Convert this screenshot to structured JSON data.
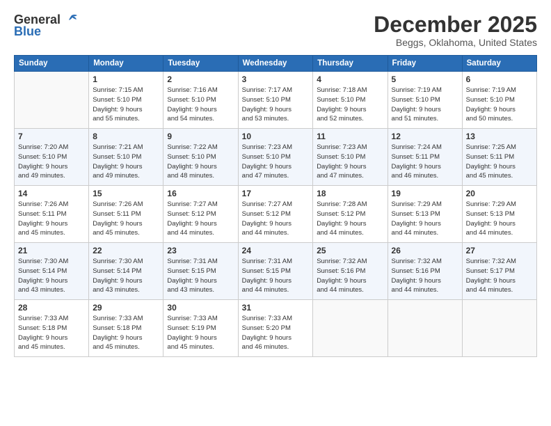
{
  "logo": {
    "line1": "General",
    "line2": "Blue"
  },
  "header": {
    "month": "December 2025",
    "location": "Beggs, Oklahoma, United States"
  },
  "weekdays": [
    "Sunday",
    "Monday",
    "Tuesday",
    "Wednesday",
    "Thursday",
    "Friday",
    "Saturday"
  ],
  "weeks": [
    [
      {
        "day": "",
        "info": ""
      },
      {
        "day": "1",
        "info": "Sunrise: 7:15 AM\nSunset: 5:10 PM\nDaylight: 9 hours\nand 55 minutes."
      },
      {
        "day": "2",
        "info": "Sunrise: 7:16 AM\nSunset: 5:10 PM\nDaylight: 9 hours\nand 54 minutes."
      },
      {
        "day": "3",
        "info": "Sunrise: 7:17 AM\nSunset: 5:10 PM\nDaylight: 9 hours\nand 53 minutes."
      },
      {
        "day": "4",
        "info": "Sunrise: 7:18 AM\nSunset: 5:10 PM\nDaylight: 9 hours\nand 52 minutes."
      },
      {
        "day": "5",
        "info": "Sunrise: 7:19 AM\nSunset: 5:10 PM\nDaylight: 9 hours\nand 51 minutes."
      },
      {
        "day": "6",
        "info": "Sunrise: 7:19 AM\nSunset: 5:10 PM\nDaylight: 9 hours\nand 50 minutes."
      }
    ],
    [
      {
        "day": "7",
        "info": "Sunrise: 7:20 AM\nSunset: 5:10 PM\nDaylight: 9 hours\nand 49 minutes."
      },
      {
        "day": "8",
        "info": "Sunrise: 7:21 AM\nSunset: 5:10 PM\nDaylight: 9 hours\nand 49 minutes."
      },
      {
        "day": "9",
        "info": "Sunrise: 7:22 AM\nSunset: 5:10 PM\nDaylight: 9 hours\nand 48 minutes."
      },
      {
        "day": "10",
        "info": "Sunrise: 7:23 AM\nSunset: 5:10 PM\nDaylight: 9 hours\nand 47 minutes."
      },
      {
        "day": "11",
        "info": "Sunrise: 7:23 AM\nSunset: 5:10 PM\nDaylight: 9 hours\nand 47 minutes."
      },
      {
        "day": "12",
        "info": "Sunrise: 7:24 AM\nSunset: 5:11 PM\nDaylight: 9 hours\nand 46 minutes."
      },
      {
        "day": "13",
        "info": "Sunrise: 7:25 AM\nSunset: 5:11 PM\nDaylight: 9 hours\nand 45 minutes."
      }
    ],
    [
      {
        "day": "14",
        "info": "Sunrise: 7:26 AM\nSunset: 5:11 PM\nDaylight: 9 hours\nand 45 minutes."
      },
      {
        "day": "15",
        "info": "Sunrise: 7:26 AM\nSunset: 5:11 PM\nDaylight: 9 hours\nand 45 minutes."
      },
      {
        "day": "16",
        "info": "Sunrise: 7:27 AM\nSunset: 5:12 PM\nDaylight: 9 hours\nand 44 minutes."
      },
      {
        "day": "17",
        "info": "Sunrise: 7:27 AM\nSunset: 5:12 PM\nDaylight: 9 hours\nand 44 minutes."
      },
      {
        "day": "18",
        "info": "Sunrise: 7:28 AM\nSunset: 5:12 PM\nDaylight: 9 hours\nand 44 minutes."
      },
      {
        "day": "19",
        "info": "Sunrise: 7:29 AM\nSunset: 5:13 PM\nDaylight: 9 hours\nand 44 minutes."
      },
      {
        "day": "20",
        "info": "Sunrise: 7:29 AM\nSunset: 5:13 PM\nDaylight: 9 hours\nand 44 minutes."
      }
    ],
    [
      {
        "day": "21",
        "info": "Sunrise: 7:30 AM\nSunset: 5:14 PM\nDaylight: 9 hours\nand 43 minutes."
      },
      {
        "day": "22",
        "info": "Sunrise: 7:30 AM\nSunset: 5:14 PM\nDaylight: 9 hours\nand 43 minutes."
      },
      {
        "day": "23",
        "info": "Sunrise: 7:31 AM\nSunset: 5:15 PM\nDaylight: 9 hours\nand 43 minutes."
      },
      {
        "day": "24",
        "info": "Sunrise: 7:31 AM\nSunset: 5:15 PM\nDaylight: 9 hours\nand 44 minutes."
      },
      {
        "day": "25",
        "info": "Sunrise: 7:32 AM\nSunset: 5:16 PM\nDaylight: 9 hours\nand 44 minutes."
      },
      {
        "day": "26",
        "info": "Sunrise: 7:32 AM\nSunset: 5:16 PM\nDaylight: 9 hours\nand 44 minutes."
      },
      {
        "day": "27",
        "info": "Sunrise: 7:32 AM\nSunset: 5:17 PM\nDaylight: 9 hours\nand 44 minutes."
      }
    ],
    [
      {
        "day": "28",
        "info": "Sunrise: 7:33 AM\nSunset: 5:18 PM\nDaylight: 9 hours\nand 45 minutes."
      },
      {
        "day": "29",
        "info": "Sunrise: 7:33 AM\nSunset: 5:18 PM\nDaylight: 9 hours\nand 45 minutes."
      },
      {
        "day": "30",
        "info": "Sunrise: 7:33 AM\nSunset: 5:19 PM\nDaylight: 9 hours\nand 45 minutes."
      },
      {
        "day": "31",
        "info": "Sunrise: 7:33 AM\nSunset: 5:20 PM\nDaylight: 9 hours\nand 46 minutes."
      },
      {
        "day": "",
        "info": ""
      },
      {
        "day": "",
        "info": ""
      },
      {
        "day": "",
        "info": ""
      }
    ]
  ]
}
